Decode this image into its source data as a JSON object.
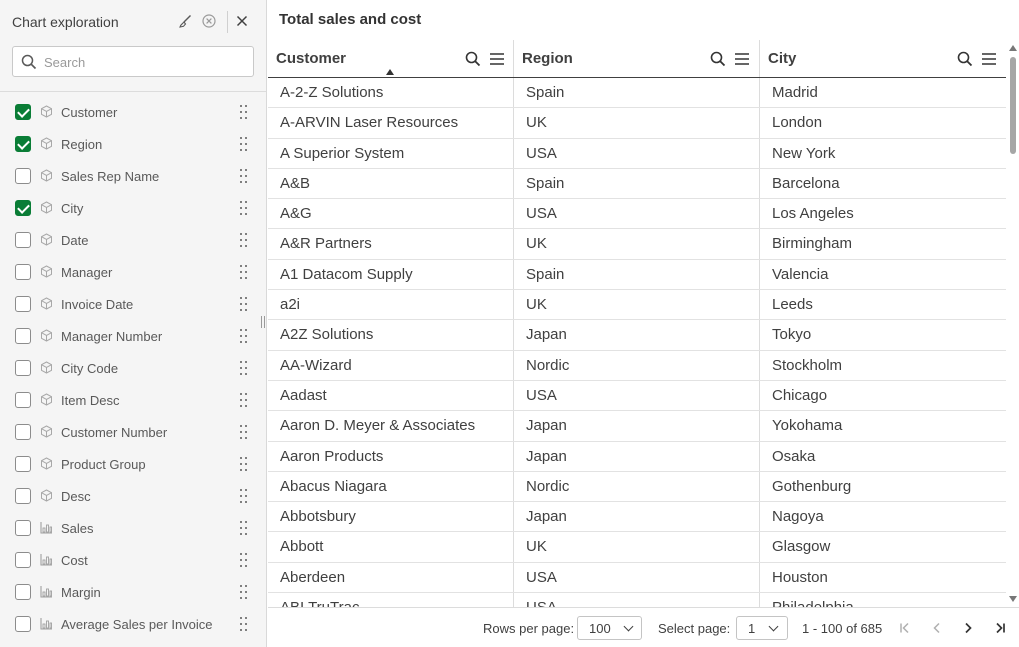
{
  "sidebar": {
    "title": "Chart exploration",
    "search_placeholder": "Search",
    "fields": [
      {
        "label": "Customer",
        "checked": true,
        "kind": "dimension"
      },
      {
        "label": "Region",
        "checked": true,
        "kind": "dimension"
      },
      {
        "label": "Sales Rep Name",
        "checked": false,
        "kind": "dimension"
      },
      {
        "label": "City",
        "checked": true,
        "kind": "dimension"
      },
      {
        "label": "Date",
        "checked": false,
        "kind": "dimension"
      },
      {
        "label": "Manager",
        "checked": false,
        "kind": "dimension"
      },
      {
        "label": "Invoice Date",
        "checked": false,
        "kind": "dimension"
      },
      {
        "label": "Manager Number",
        "checked": false,
        "kind": "dimension"
      },
      {
        "label": "City Code",
        "checked": false,
        "kind": "dimension"
      },
      {
        "label": "Item Desc",
        "checked": false,
        "kind": "dimension"
      },
      {
        "label": "Customer Number",
        "checked": false,
        "kind": "dimension"
      },
      {
        "label": "Product Group",
        "checked": false,
        "kind": "dimension"
      },
      {
        "label": "Desc",
        "checked": false,
        "kind": "dimension"
      },
      {
        "label": "Sales",
        "checked": false,
        "kind": "measure"
      },
      {
        "label": "Cost",
        "checked": false,
        "kind": "measure"
      },
      {
        "label": "Margin",
        "checked": false,
        "kind": "measure"
      },
      {
        "label": "Average Sales per Invoice",
        "checked": false,
        "kind": "measure"
      }
    ]
  },
  "main": {
    "title": "Total sales and cost",
    "columns": [
      "Customer",
      "Region",
      "City"
    ],
    "sorted_column": "Customer",
    "rows": [
      [
        "A-2-Z Solutions",
        "Spain",
        "Madrid"
      ],
      [
        "A-ARVIN Laser Resources",
        "UK",
        "London"
      ],
      [
        "A Superior System",
        "USA",
        "New York"
      ],
      [
        "A&B",
        "Spain",
        "Barcelona"
      ],
      [
        "A&G",
        "USA",
        "Los Angeles"
      ],
      [
        "A&R Partners",
        "UK",
        "Birmingham"
      ],
      [
        "A1 Datacom Supply",
        "Spain",
        "Valencia"
      ],
      [
        "a2i",
        "UK",
        "Leeds"
      ],
      [
        "A2Z Solutions",
        "Japan",
        "Tokyo"
      ],
      [
        "AA-Wizard",
        "Nordic",
        "Stockholm"
      ],
      [
        "Aadast",
        "USA",
        "Chicago"
      ],
      [
        "Aaron D. Meyer & Associates",
        "Japan",
        "Yokohama"
      ],
      [
        "Aaron Products",
        "Japan",
        "Osaka"
      ],
      [
        "Abacus Niagara",
        "Nordic",
        "Gothenburg"
      ],
      [
        "Abbotsbury",
        "Japan",
        "Nagoya"
      ],
      [
        "Abbott",
        "UK",
        "Glasgow"
      ],
      [
        "Aberdeen",
        "USA",
        "Houston"
      ],
      [
        "ABI TruTrac",
        "USA",
        "Philadelphia"
      ]
    ],
    "footer": {
      "rows_per_page_label": "Rows per page:",
      "rows_per_page_value": "100",
      "select_page_label": "Select page:",
      "select_page_value": "1",
      "range_text": "1 - 100 of 685"
    }
  },
  "icons": {
    "header": [
      "brush-icon",
      "clear-selection-icon",
      "close-icon"
    ],
    "column": [
      "search-icon",
      "menu-icon"
    ],
    "nav": [
      "first-page-icon",
      "previous-page-icon",
      "next-page-icon",
      "last-page-icon"
    ]
  },
  "colors": {
    "checkbox_checked": "#0a7d36",
    "sidebar_bg": "#f5f5f5"
  }
}
